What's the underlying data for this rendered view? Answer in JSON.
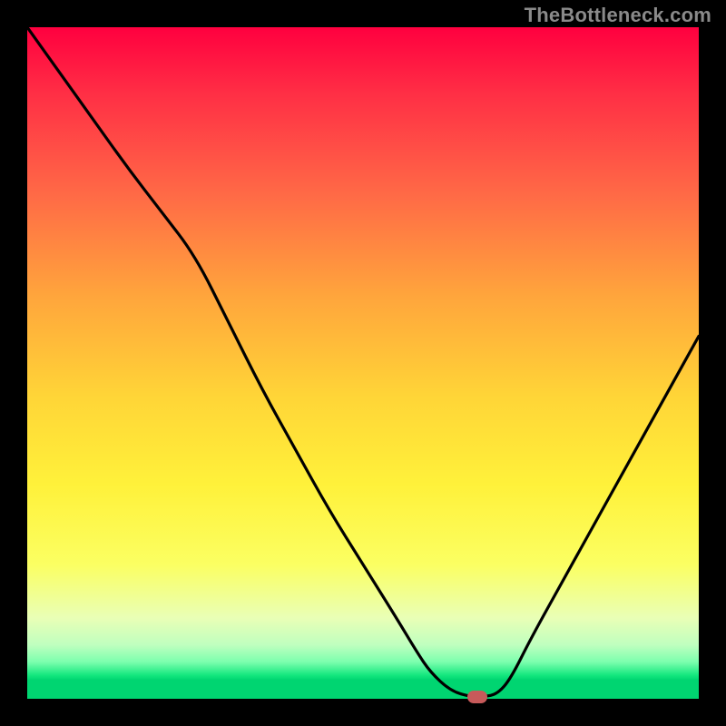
{
  "watermark": "TheBottleneck.com",
  "colors": {
    "background": "#000000",
    "curve": "#000000",
    "marker": "#c75a5a",
    "watermark_text": "#8a8a8a"
  },
  "chart_data": {
    "type": "line",
    "title": "",
    "xlabel": "",
    "ylabel": "",
    "xlim": [
      0,
      100
    ],
    "ylim": [
      0,
      100
    ],
    "x": [
      0,
      5,
      10,
      15,
      20,
      25,
      30,
      35,
      40,
      45,
      50,
      55,
      58,
      60,
      63,
      66,
      68,
      70,
      72,
      75,
      80,
      85,
      90,
      95,
      100
    ],
    "values": [
      100,
      93,
      86,
      79,
      72.5,
      66,
      56,
      46,
      37,
      28,
      20,
      12,
      7,
      4,
      1.2,
      0.3,
      0.3,
      0.7,
      3,
      9,
      18,
      27,
      36,
      45,
      54
    ],
    "marker": {
      "x": 67,
      "y": 0.3
    },
    "grid": false,
    "legend": false
  }
}
